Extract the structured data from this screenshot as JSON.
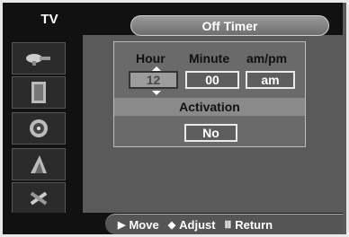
{
  "header": {
    "tv_label": "TV",
    "title": "Off Timer"
  },
  "sidebar": {
    "items": [
      {
        "icon": "satellite-dish-icon"
      },
      {
        "icon": "speaker-box-icon"
      },
      {
        "icon": "loudspeaker-icon"
      },
      {
        "icon": "antenna-icon"
      },
      {
        "icon": "tools-icon"
      }
    ]
  },
  "timer": {
    "hour_label": "Hour",
    "minute_label": "Minute",
    "ampm_label": "am/pm",
    "hour_value": "12",
    "minute_value": "00",
    "ampm_value": "am",
    "activation_label": "Activation",
    "activation_value": "No"
  },
  "footer": {
    "move": "Move",
    "adjust": "Adjust",
    "return": "Return"
  }
}
